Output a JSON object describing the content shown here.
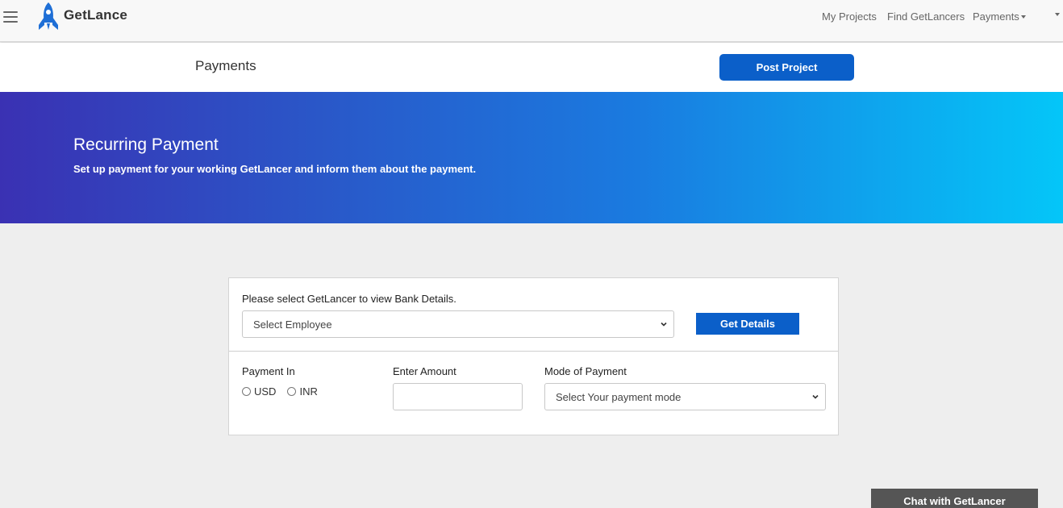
{
  "nav": {
    "brand": "GetLance",
    "links": [
      "My Projects",
      "Find GetLancers",
      "Payments"
    ]
  },
  "subheader": {
    "title": "Payments",
    "post_button": "Post Project"
  },
  "hero": {
    "title": "Recurring Payment",
    "subtitle": "Set up payment for your working GetLancer and inform them about the payment."
  },
  "form": {
    "employee_label": "Please select GetLancer to view Bank Details.",
    "employee_select": "Select Employee",
    "details_button": "Get Details",
    "payment_in_label": "Payment In",
    "currency_options": [
      "USD",
      "INR"
    ],
    "amount_label": "Enter Amount",
    "amount_value": "",
    "mode_label": "Mode of Payment",
    "mode_select": "Select Your payment mode"
  },
  "chat": {
    "label": "Chat with GetLancer"
  },
  "colors": {
    "accent": "#0b5fc9",
    "hero_start": "#3a31b3",
    "hero_end": "#04c6f8",
    "chat_bg": "#555555"
  }
}
